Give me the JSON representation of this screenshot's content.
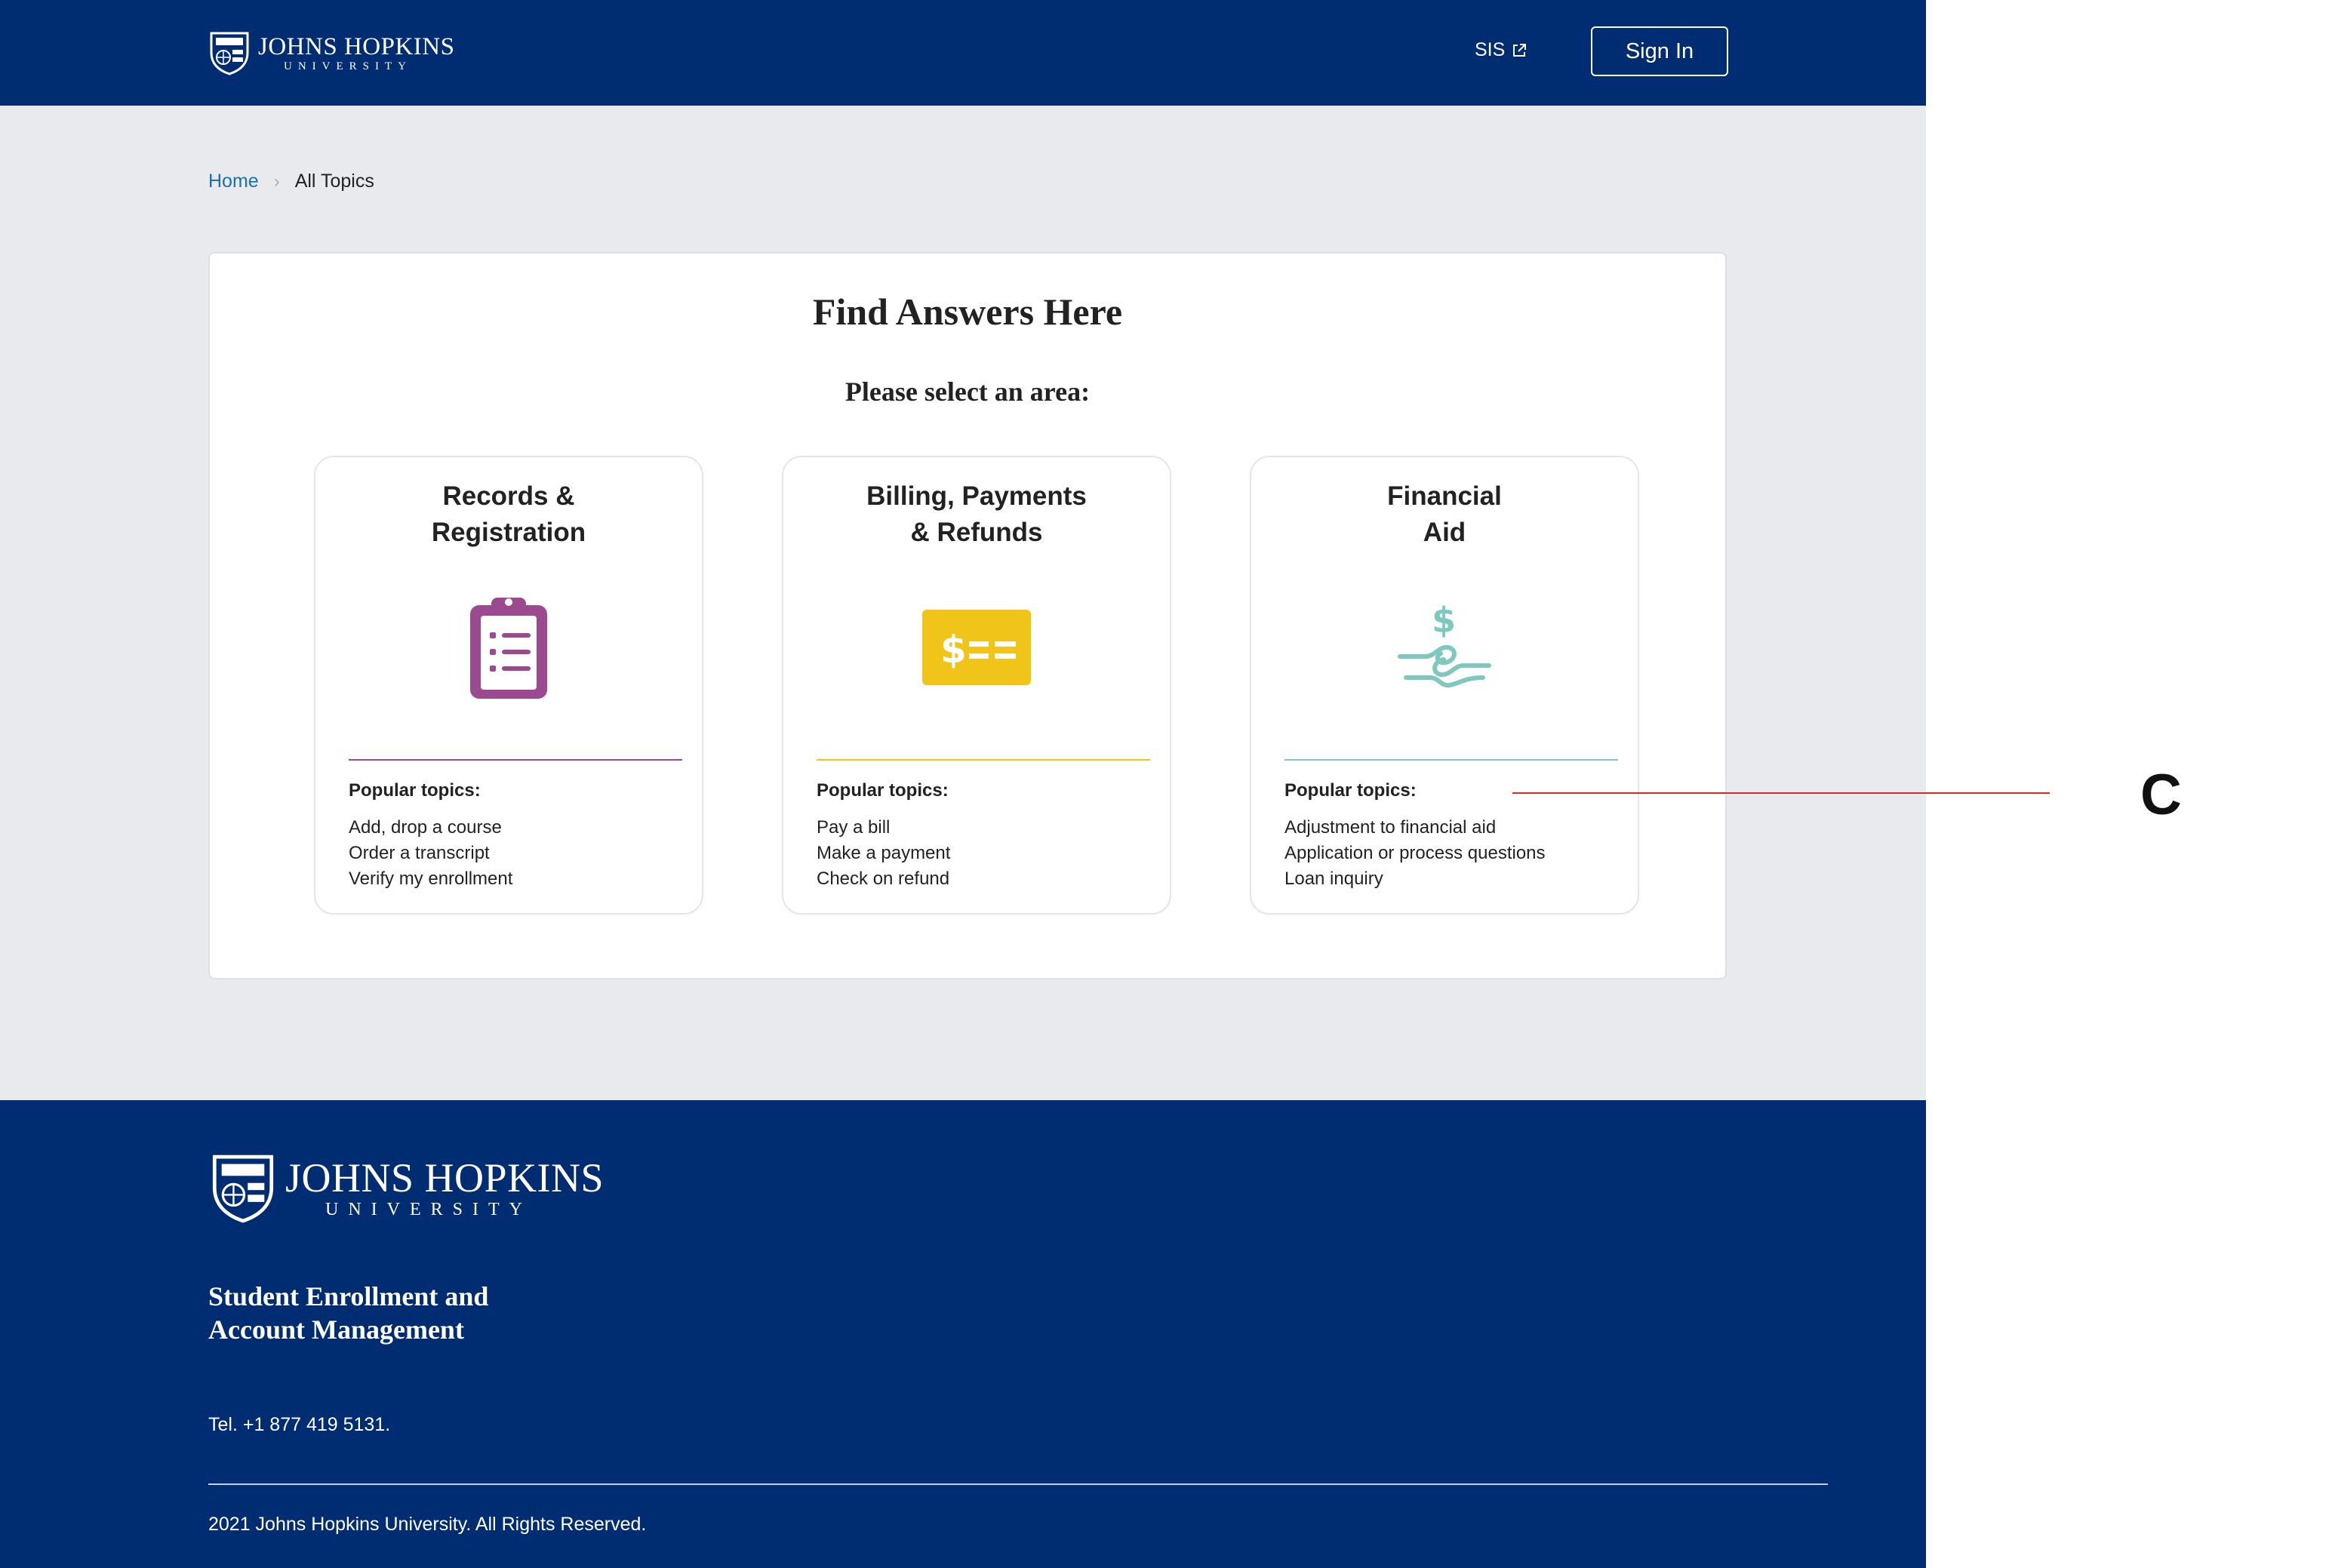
{
  "header": {
    "logo": {
      "line1": "JOHNS HOPKINS",
      "line2": "UNIVERSITY"
    },
    "sis_label": "SIS",
    "signin_label": "Sign In"
  },
  "breadcrumb": {
    "home": "Home",
    "separator": "›",
    "current": "All Topics"
  },
  "main": {
    "title": "Find Answers Here",
    "subtitle": "Please select an area:",
    "cards": [
      {
        "title_line1": "Records &",
        "title_line2": "Registration",
        "icon": "clipboard-icon",
        "accent": "#9b4a8f",
        "popular_label": "Popular topics:",
        "topics": [
          "Add, drop a course",
          "Order a transcript",
          "Verify my enrollment"
        ]
      },
      {
        "title_line1": "Billing, Payments",
        "title_line2": "& Refunds",
        "icon": "bill-icon",
        "accent": "#f0c419",
        "popular_label": "Popular topics:",
        "topics": [
          "Pay a bill",
          "Make a payment",
          "Check on refund"
        ]
      },
      {
        "title_line1": "Financial",
        "title_line2": "Aid",
        "icon": "handshake-dollar-icon",
        "accent": "#7ec8be",
        "popular_label": "Popular topics:",
        "topics": [
          "Adjustment to financial aid",
          "Application or process questions",
          "Loan inquiry"
        ]
      }
    ]
  },
  "footer": {
    "logo": {
      "line1": "JOHNS HOPKINS",
      "line2": "UNIVERSITY"
    },
    "title_line1": "Student Enrollment and",
    "title_line2": "Account Management",
    "tel": "Tel. +1 877 419 5131.",
    "copyright": "2021 Johns Hopkins University. All Rights Reserved."
  },
  "annotation": {
    "label": "C",
    "color": "#d62a2a"
  },
  "colors": {
    "brand_navy": "#002d72",
    "page_bg": "#e8eaed",
    "link": "#1a6fb5"
  }
}
